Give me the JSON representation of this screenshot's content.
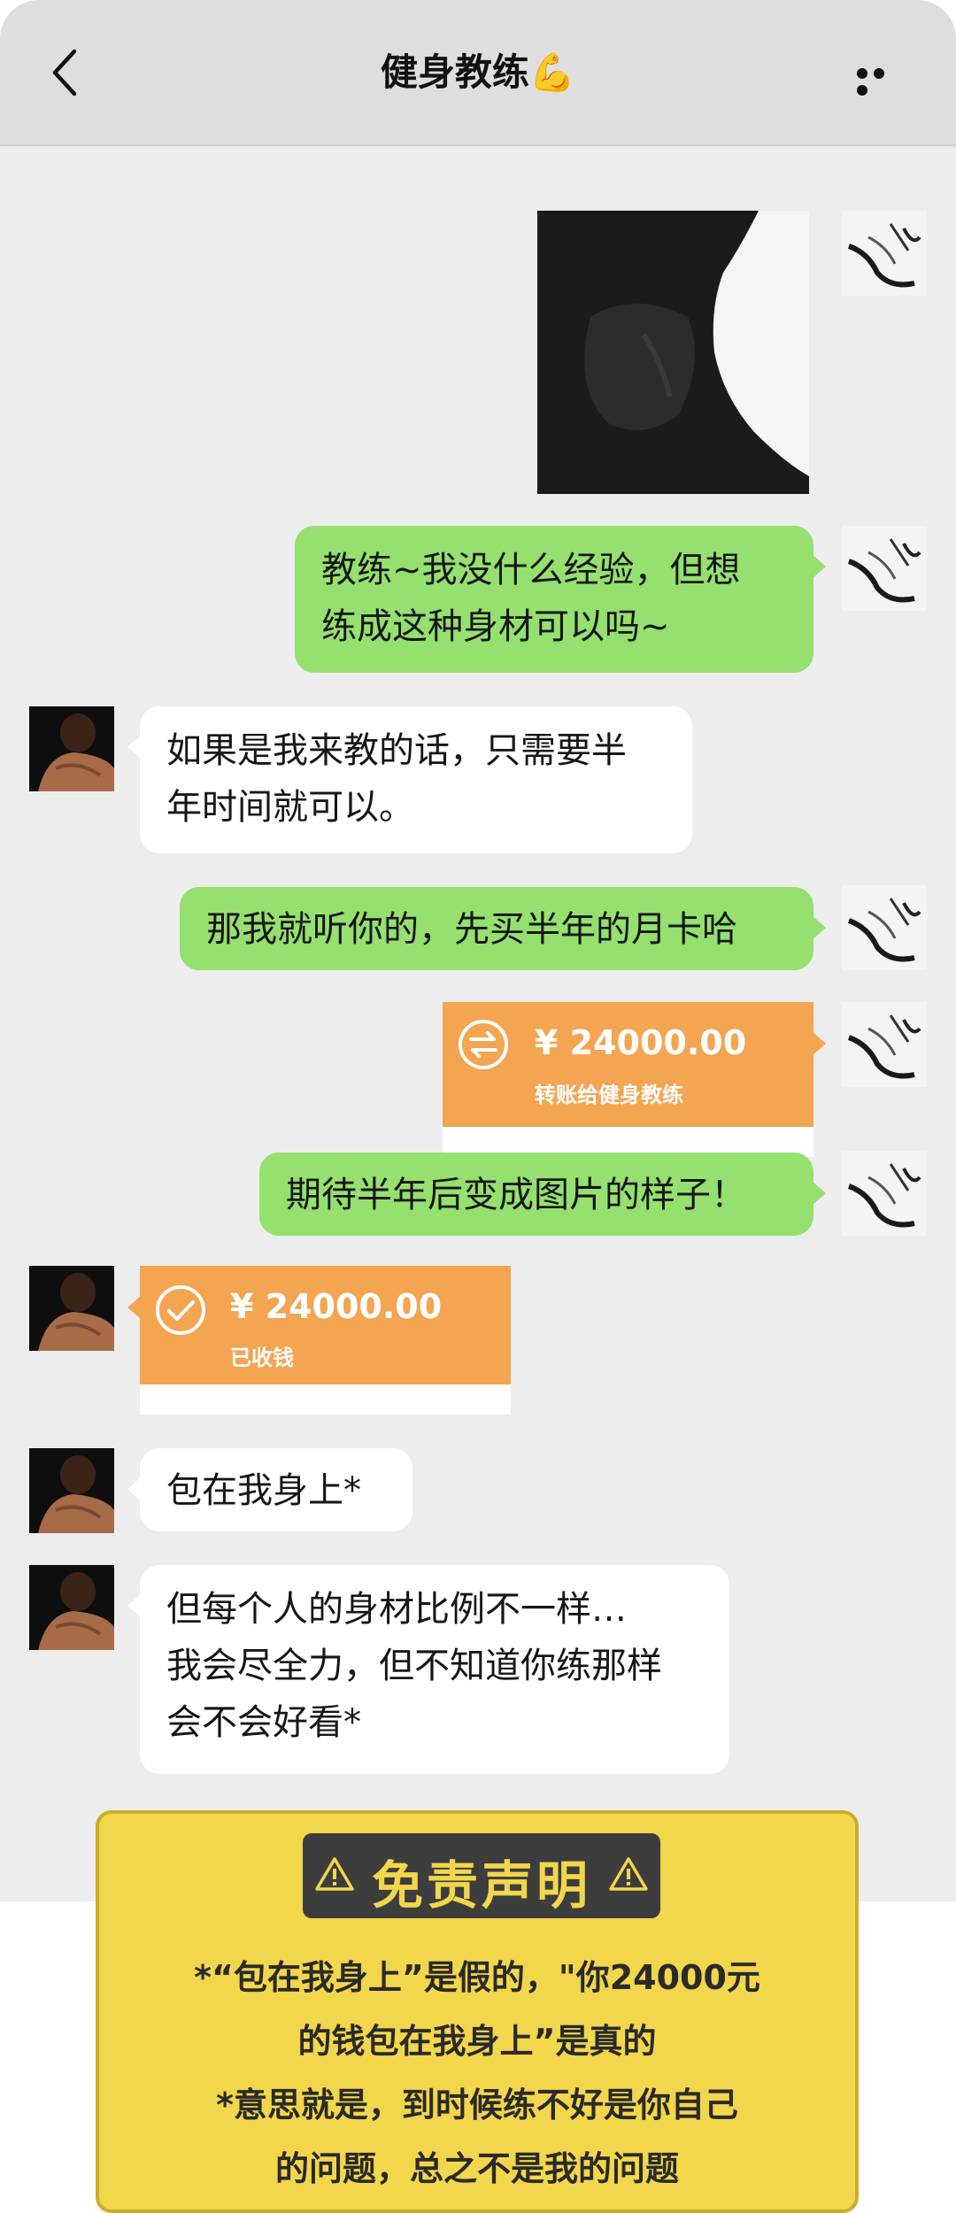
{
  "header": {
    "title": "健身教练💪"
  },
  "messages": {
    "m1": {
      "line1": "教练~我没什么经验，但想",
      "line2": "练成这种身材可以吗~"
    },
    "m2": {
      "line1": "如果是我来教的话，只需要半",
      "line2": "年时间就可以。"
    },
    "m3": {
      "text": "那我就听你的，先买半年的月卡哈"
    },
    "m4": {
      "amount": "¥ 24000.00",
      "note": "转账给健身教练"
    },
    "m5": {
      "text": "期待半年后变成图片的样子！"
    },
    "m6": {
      "amount": "¥ 24000.00",
      "note": "已收钱"
    },
    "m7": {
      "text": "包在我身上*"
    },
    "m8": {
      "line1": "但每个人的身材比例不一样…",
      "line2": "我会尽全力，但不知道你练那样",
      "line3": "会不会好看*"
    }
  },
  "disclaimer": {
    "title": "免责声明",
    "line1": "*“包在我身上”是假的，\"你24000元",
    "line2": "的钱包在我身上”是真的",
    "line3": "*意思就是，到时候练不好是你自己",
    "line4": "的问题，总之不是我的问题"
  }
}
